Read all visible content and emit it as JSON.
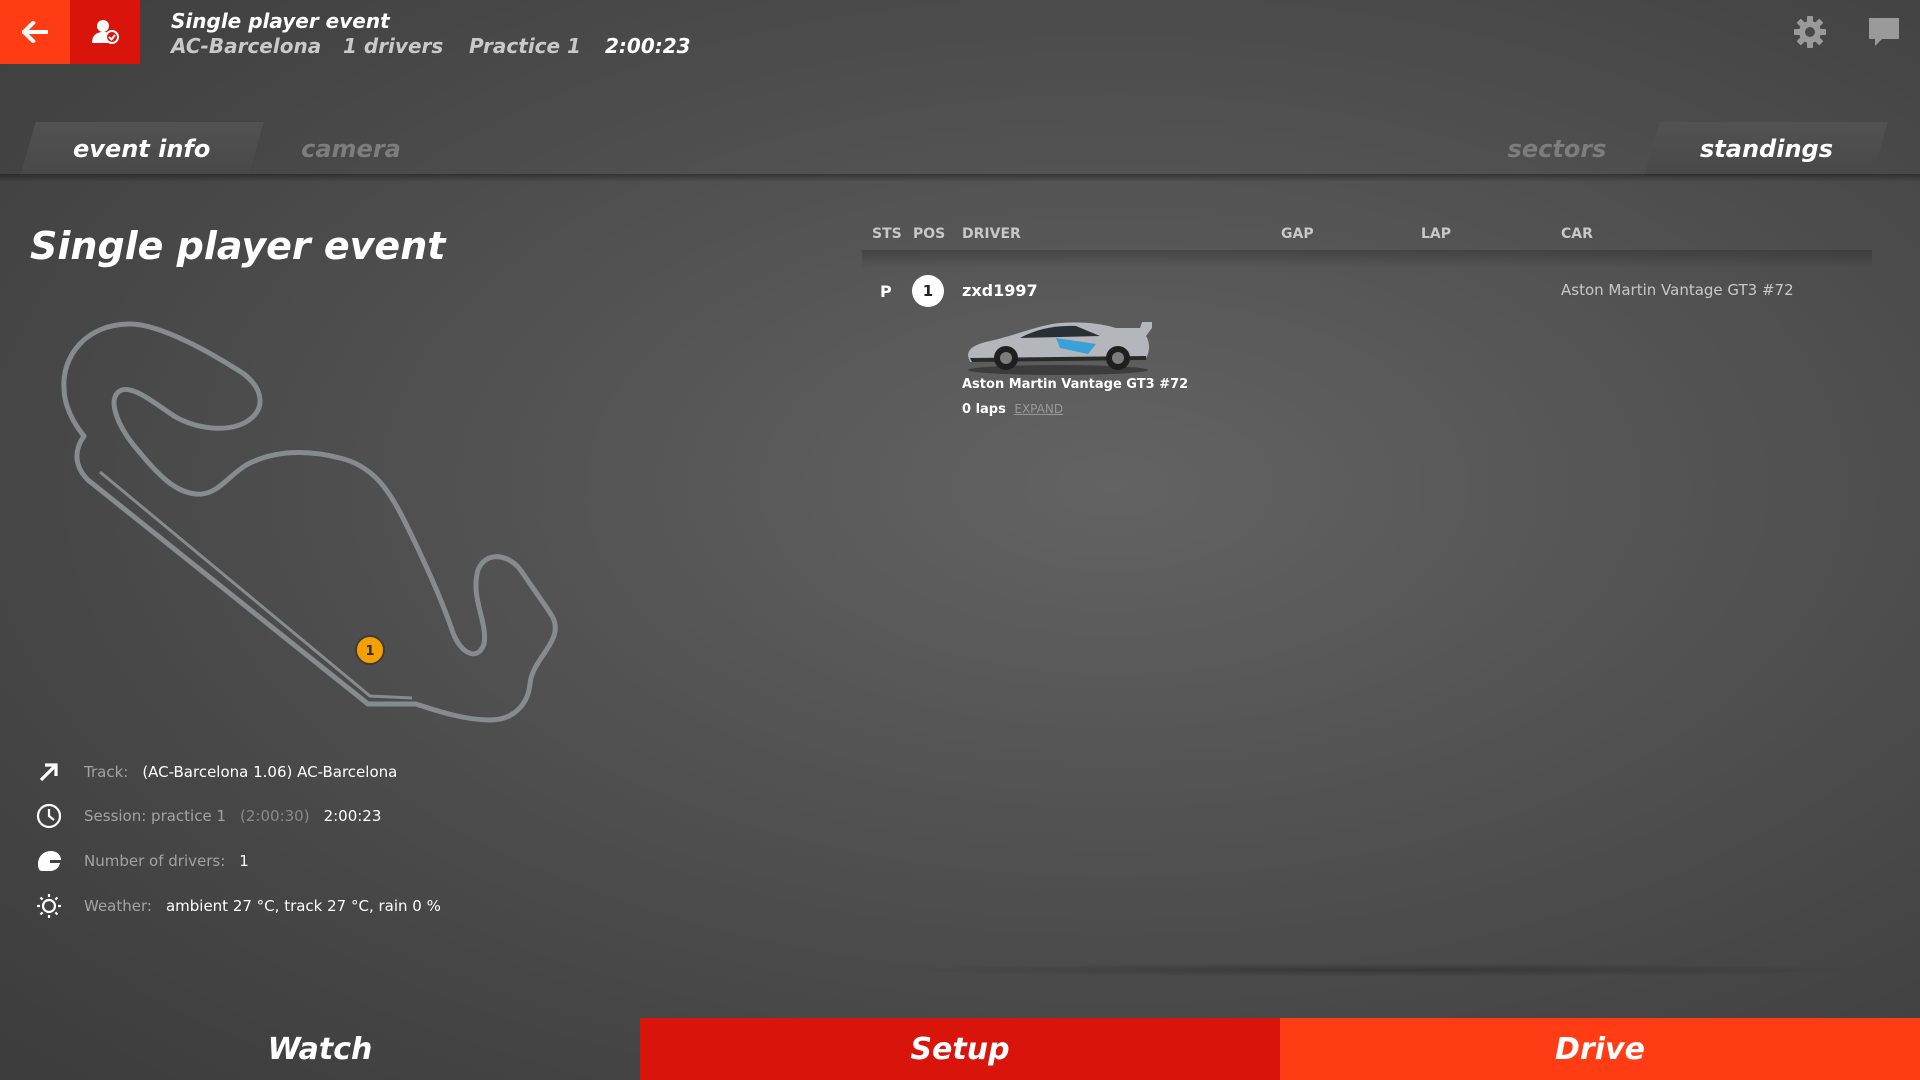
{
  "header": {
    "title": "Single player event",
    "track": "AC-Barcelona",
    "drivers": "1 drivers",
    "session": "Practice 1",
    "time": "2:00:23"
  },
  "tabs": {
    "left": [
      {
        "label": "event info",
        "active": true
      },
      {
        "label": "camera",
        "active": false
      }
    ],
    "right": [
      {
        "label": "sectors",
        "active": false
      },
      {
        "label": "standings",
        "active": true
      }
    ]
  },
  "event": {
    "title": "Single player event",
    "map_marker": "1",
    "info": {
      "track_label": "Track:",
      "track_value": "(AC-Barcelona 1.06) AC-Barcelona",
      "session_label": "Session: practice 1",
      "session_duration": "(2:00:30)",
      "session_value": "2:00:23",
      "drivers_label": "Number of drivers:",
      "drivers_value": "1",
      "weather_label": "Weather:",
      "weather_value": "ambient 27 °C, track 27 °C, rain 0 %"
    }
  },
  "standings": {
    "headers": {
      "sts": "STS",
      "pos": "POS",
      "driver": "DRIVER",
      "gap": "GAP",
      "lap": "LAP",
      "car": "CAR"
    },
    "rows": [
      {
        "sts": "P",
        "pos": "1",
        "driver": "zxd1997",
        "car": "Aston Martin Vantage GT3 #72",
        "car_detail": "Aston Martin Vantage GT3 #72",
        "laps": "0 laps",
        "expand": "EXPAND"
      }
    ]
  },
  "bottom": {
    "watch": "Watch",
    "setup": "Setup",
    "drive": "Drive"
  },
  "colors": {
    "accent_orange": "#ff3c14",
    "accent_red": "#d9140a",
    "marker": "#f5a000",
    "track_line": "#868b8e"
  },
  "icons": {
    "back": "arrow-left-icon",
    "profile": "driver-profile-icon",
    "settings": "gear-icon",
    "chat": "chat-icon",
    "track": "arrow-up-right-icon",
    "session": "clock-icon",
    "drivers": "helmet-icon",
    "weather": "sun-icon"
  }
}
